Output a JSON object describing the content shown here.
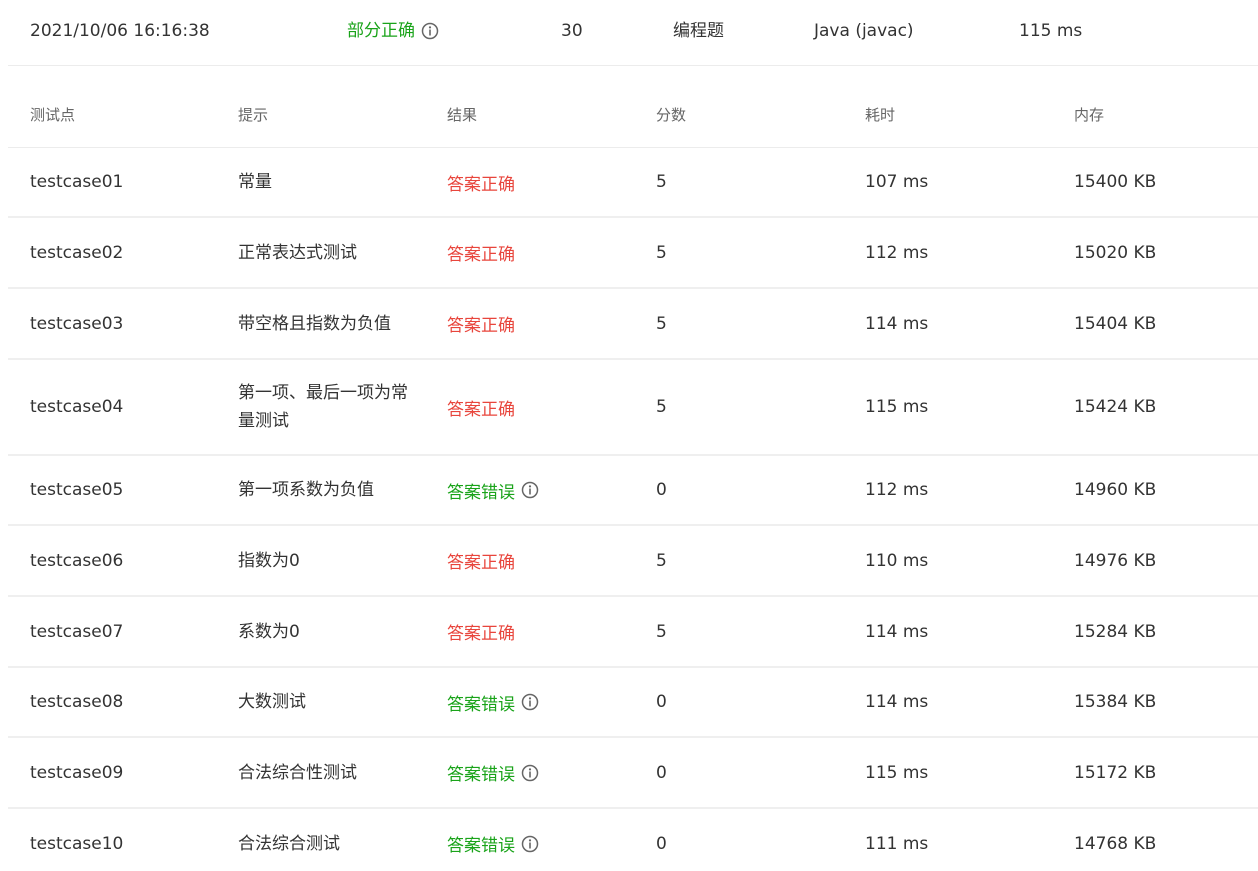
{
  "summary": {
    "time": "2021/10/06 16:16:38",
    "status": "部分正确",
    "score": "30",
    "type": "编程题",
    "language": "Java (javac)",
    "time_cost": "115 ms"
  },
  "table": {
    "headers": [
      "测试点",
      "提示",
      "结果",
      "分数",
      "耗时",
      "内存"
    ],
    "rows": [
      {
        "id": "testcase01",
        "hint": "常量",
        "result": "答案正确",
        "result_kind": "ok",
        "score": "5",
        "time": "107 ms",
        "memory": "15400 KB"
      },
      {
        "id": "testcase02",
        "hint": "正常表达式测试",
        "result": "答案正确",
        "result_kind": "ok",
        "score": "5",
        "time": "112 ms",
        "memory": "15020 KB"
      },
      {
        "id": "testcase03",
        "hint": "带空格且指数为负值",
        "result": "答案正确",
        "result_kind": "ok",
        "score": "5",
        "time": "114 ms",
        "memory": "15404 KB"
      },
      {
        "id": "testcase04",
        "hint": "第一项、最后一项为常量测试",
        "result": "答案正确",
        "result_kind": "ok",
        "score": "5",
        "time": "115 ms",
        "memory": "15424 KB"
      },
      {
        "id": "testcase05",
        "hint": "第一项系数为负值",
        "result": "答案错误",
        "result_kind": "err",
        "score": "0",
        "time": "112 ms",
        "memory": "14960 KB"
      },
      {
        "id": "testcase06",
        "hint": "指数为0",
        "result": "答案正确",
        "result_kind": "ok",
        "score": "5",
        "time": "110 ms",
        "memory": "14976 KB"
      },
      {
        "id": "testcase07",
        "hint": "系数为0",
        "result": "答案正确",
        "result_kind": "ok",
        "score": "5",
        "time": "114 ms",
        "memory": "15284 KB"
      },
      {
        "id": "testcase08",
        "hint": "大数测试",
        "result": "答案错误",
        "result_kind": "err",
        "score": "0",
        "time": "114 ms",
        "memory": "15384 KB"
      },
      {
        "id": "testcase09",
        "hint": "合法综合性测试",
        "result": "答案错误",
        "result_kind": "err",
        "score": "0",
        "time": "115 ms",
        "memory": "15172 KB"
      },
      {
        "id": "testcase10",
        "hint": "合法综合测试",
        "result": "答案错误",
        "result_kind": "err",
        "score": "0",
        "time": "111 ms",
        "memory": "14768 KB"
      }
    ]
  },
  "colors": {
    "correct": "#e8453c",
    "wrong": "#19a319",
    "partial": "#19a319",
    "border": "#ececec"
  },
  "icons": {
    "info": "info-circle-icon"
  }
}
